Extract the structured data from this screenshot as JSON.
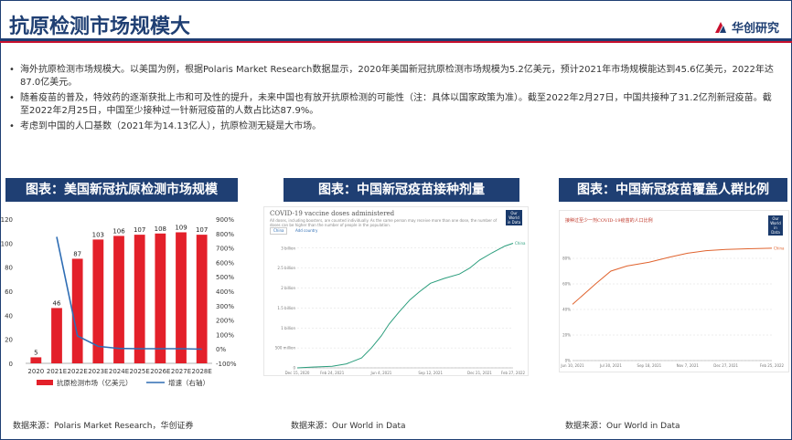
{
  "header": {
    "title": "抗原检测市场规模大",
    "logo_text": "华创研究"
  },
  "bullets": [
    "海外抗原检测市场规模大。以美国为例，根据Polaris Market Research数据显示，2020年美国新冠抗原检测市场规模为5.2亿美元，预计2021年市场规模能达到45.6亿美元，2022年达87.0亿美元。",
    "随着疫苗的普及，特效药的逐渐获批上市和可及性的提升，未来中国也有放开抗原检测的可能性（注：具体以国家政策为准）。截至2022年2月27日，中国共接种了31.2亿剂新冠疫苗。截至2022年2月25日，中国至少接种过一针新冠疫苗的人数占比达87.9%。",
    "考虑到中国的人口基数（2021年为14.13亿人），抗原检测无疑是大市场。"
  ],
  "panels": [
    {
      "title": "图表：美国新冠抗原检测市场规模",
      "source": "数据来源：Polaris Market Research，华创证券"
    },
    {
      "title": "图表：中国新冠疫苗接种剂量",
      "source": "数据来源：Our World in Data"
    },
    {
      "title": "图表：中国新冠疫苗覆盖人群比例",
      "source": "数据来源：Our World in Data"
    }
  ],
  "chart_data": [
    {
      "type": "bar",
      "categories": [
        "2020",
        "2021E",
        "2022E",
        "2023E",
        "2024E",
        "2025E",
        "2026E",
        "2027E",
        "2028E"
      ],
      "series": [
        {
          "name": "抗原检测市场（亿美元）",
          "values": [
            5,
            46,
            87,
            103,
            106,
            107,
            108,
            109,
            107
          ],
          "color": "#e3202a",
          "axis": "left"
        },
        {
          "name": "增速（右轴）",
          "type": "line",
          "values": [
            null,
            777,
            90,
            18,
            3,
            1,
            1,
            1,
            -2
          ],
          "color": "#2e6db4",
          "axis": "right"
        }
      ],
      "y_ticks_left": [
        "0",
        "20",
        "40",
        "60",
        "80",
        "100",
        "120"
      ],
      "y_ticks_right": [
        "-100%",
        "0%",
        "100%",
        "200%",
        "300%",
        "400%",
        "500%",
        "600%",
        "700%",
        "800%",
        "900%"
      ],
      "ylim": [
        0,
        120
      ],
      "ylim_right": [
        -100,
        900
      ]
    },
    {
      "type": "line",
      "title": "COVID-19 vaccine doses administered",
      "subtitle": "All doses, including boosters, are counted individually. As the same person may receive more than one dose, the number of doses can be higher than the number of people in the population.",
      "badge": "Our World in Data",
      "buttons": [
        "China",
        "Add country"
      ],
      "x_ticks": [
        "Dec 15, 2020",
        "Feb 24, 2021",
        "Jun 4, 2021",
        "Sep 12, 2021",
        "Dec 21, 2021",
        "Feb 27, 2022"
      ],
      "y_ticks": [
        "0",
        "500 million",
        "1 billion",
        "1.5 billion",
        "2 billion",
        "2.5 billion",
        "3 billion"
      ],
      "x": [
        "2020-12-15",
        "2021-01-15",
        "2021-02-24",
        "2021-03-25",
        "2021-04-25",
        "2021-05-15",
        "2021-06-04",
        "2021-06-20",
        "2021-07-10",
        "2021-08-01",
        "2021-08-20",
        "2021-09-12",
        "2021-10-10",
        "2021-11-10",
        "2021-12-01",
        "2021-12-21",
        "2022-01-15",
        "2022-02-10",
        "2022-02-27"
      ],
      "series": [
        {
          "name": "China",
          "color": "#2a9d7c",
          "values": [
            0.0,
            0.02,
            0.04,
            0.1,
            0.25,
            0.5,
            0.8,
            1.1,
            1.4,
            1.7,
            1.9,
            2.12,
            2.24,
            2.35,
            2.5,
            2.7,
            2.88,
            3.05,
            3.12
          ]
        }
      ],
      "ylim": [
        0,
        3.2
      ]
    },
    {
      "type": "line",
      "title": "接种过至少一剂COVID-19疫苗的人口比例",
      "badge": "Our World in Data",
      "x_ticks": [
        "Jun 10, 2021",
        "Jul 30, 2021",
        "Sep 18, 2021",
        "Nov 7, 2021",
        "Dec 27, 2021",
        "Feb 25, 2022"
      ],
      "y_ticks": [
        "0%",
        "20%",
        "40%",
        "60%",
        "80%"
      ],
      "x": [
        "2021-06-10",
        "2021-07-10",
        "2021-07-30",
        "2021-08-20",
        "2021-09-18",
        "2021-10-15",
        "2021-11-07",
        "2021-12-01",
        "2021-12-27",
        "2022-01-25",
        "2022-02-25"
      ],
      "series": [
        {
          "name": "China",
          "color": "#e0632e",
          "values": [
            44,
            60,
            70,
            74,
            77,
            81,
            84,
            86,
            87,
            87.5,
            87.9
          ]
        }
      ],
      "ylim": [
        0,
        100
      ]
    }
  ]
}
